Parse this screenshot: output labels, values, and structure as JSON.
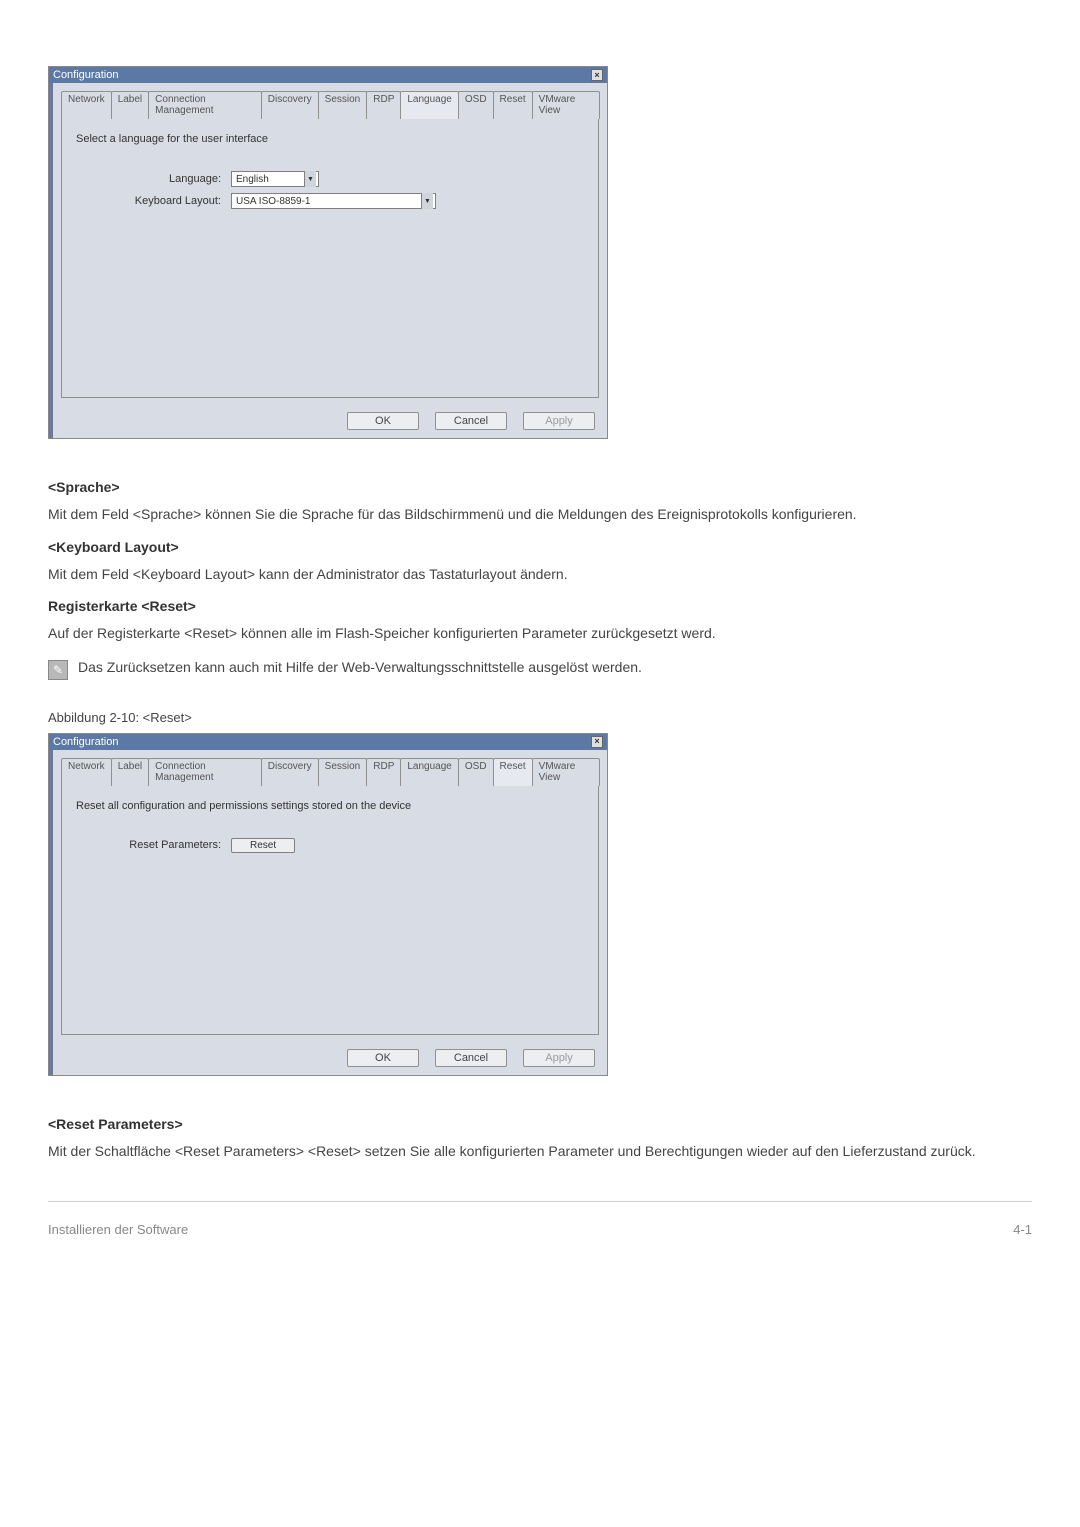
{
  "tabs": [
    "Network",
    "Label",
    "Connection Management",
    "Discovery",
    "Session",
    "RDP",
    "Language",
    "OSD",
    "Reset",
    "VMware View"
  ],
  "dialog1": {
    "title": "Configuration",
    "active_tab": "Language",
    "instruction": "Select a language for the user interface",
    "language_label": "Language:",
    "language_value": "English",
    "keyboard_label": "Keyboard Layout:",
    "keyboard_value": "USA ISO-8859-1",
    "ok": "OK",
    "cancel": "Cancel",
    "apply": "Apply"
  },
  "dialog2": {
    "title": "Configuration",
    "active_tab": "Reset",
    "instruction": "Reset all configuration and permissions settings stored on the device",
    "reset_label": "Reset Parameters:",
    "reset_button": "Reset",
    "ok": "OK",
    "cancel": "Cancel",
    "apply": "Apply"
  },
  "text": {
    "sprache_heading": "<Sprache>",
    "sprache_body": "Mit dem Feld <Sprache> können Sie die Sprache für das Bildschirmmenü und die Meldungen des Ereignisprotokolls konfigurieren.",
    "keyboard_heading": "<Keyboard Layout>",
    "keyboard_body": "Mit dem Feld <Keyboard Layout> kann der Administrator das Tastaturlayout ändern.",
    "reset_tab_heading": "Registerkarte <Reset>",
    "reset_tab_body": "Auf der Registerkarte <Reset> können alle im Flash-Speicher konfigurierten Parameter zurückgesetzt werd.",
    "note": "Das Zurücksetzen kann auch mit Hilfe der Web-Verwaltungsschnittstelle ausgelöst werden.",
    "fig_caption": "Abbildung 2-10: <Reset>",
    "reset_param_heading": "<Reset Parameters>",
    "reset_param_body": "Mit der Schaltfläche <Reset Parameters> <Reset> setzen Sie alle konfigurierten Parameter und Berechtigungen wieder auf den Lieferzustand zurück."
  },
  "footer": {
    "left": "Installieren der Software",
    "right": "4-1"
  }
}
